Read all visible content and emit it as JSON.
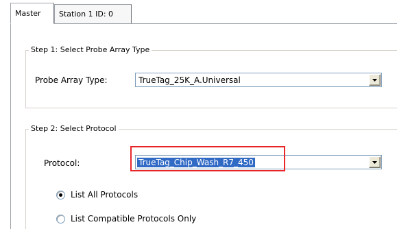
{
  "tabs": [
    {
      "label": "Master",
      "active": true
    },
    {
      "label": "Station 1  ID: 0",
      "active": false
    }
  ],
  "step1": {
    "title": "Step 1: Select Probe Array Type",
    "field_label": "Probe Array Type:",
    "field_value": "TrueTag_25K_A.Universal"
  },
  "step2": {
    "title": "Step 2: Select Protocol",
    "field_label": "Protocol:",
    "field_value": "TrueTag_Chip_Wash_R7_450",
    "options": [
      {
        "label": "List All Protocols",
        "selected": true
      },
      {
        "label": "List Compatible Protocols Only",
        "selected": false
      }
    ]
  },
  "icons": {
    "dropdown_arrow": "chevron-down-icon"
  },
  "colors": {
    "highlight": "#e8262a",
    "selection": "#316ac5"
  }
}
